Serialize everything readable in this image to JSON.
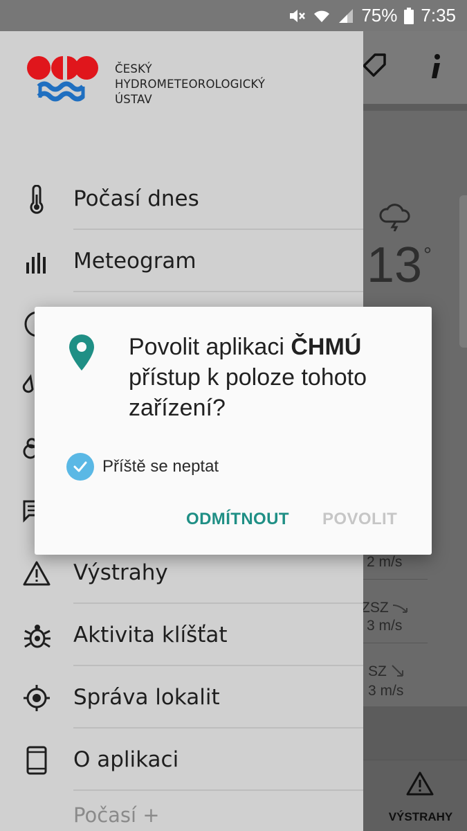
{
  "status_bar": {
    "battery": "75%",
    "time": "7:35"
  },
  "background_app": {
    "temperature": "13",
    "temperature_unit": "°",
    "wind_rows": [
      {
        "direction": "",
        "speed": "2 m/s"
      },
      {
        "direction": "ZSZ",
        "speed": "3 m/s"
      },
      {
        "direction": "SZ",
        "speed": "3 m/s"
      }
    ],
    "bottom_nav_label": "VÝSTRAHY"
  },
  "drawer": {
    "logo_text_lines": [
      "ČESKÝ",
      "HYDROMETEOROLOGICKÝ",
      "ÚSTAV"
    ],
    "logo_colors": {
      "red": "#e0161c",
      "blue": "#1f6fc0"
    },
    "items": [
      {
        "label": "Počasí dnes",
        "icon": "thermometer-icon"
      },
      {
        "label": "Meteogram",
        "icon": "bar-chart-icon"
      },
      {
        "label": "Výstrahy",
        "icon": "warning-icon"
      },
      {
        "label": "Aktivita klíšťat",
        "icon": "tick-icon"
      },
      {
        "label": "Správa lokalit",
        "icon": "location-target-icon"
      },
      {
        "label": "O aplikaci",
        "icon": "phone-icon"
      }
    ],
    "extra_label": "Počasí +"
  },
  "dialog": {
    "message_prefix": "Povolit aplikaci ",
    "app_name": "ČHMÚ",
    "message_suffix": " přístup k poloze tohoto zařízení?",
    "checkbox_label": "Příště se neptat",
    "checkbox_checked": true,
    "deny_button": "ODMÍTNOUT",
    "allow_button": "POVOLIT",
    "accent_color": "#1f8f85",
    "checkbox_color": "#5ab8e5"
  }
}
